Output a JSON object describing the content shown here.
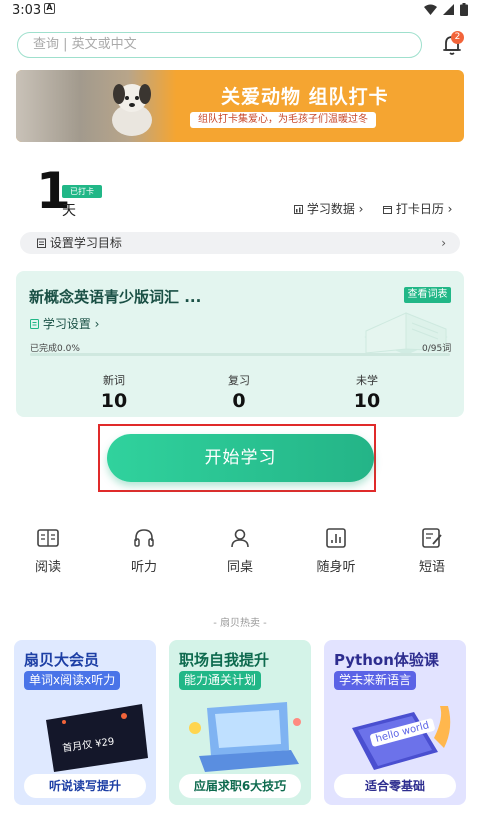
{
  "status_bar": {
    "time": "3:03",
    "notification_icon": "A"
  },
  "search": {
    "placeholder": "查询 | 英文或中文"
  },
  "notifications": {
    "count": "2"
  },
  "banner": {
    "title": "关爱动物  组队打卡",
    "subtitle": "组队打卡集爱心，为毛孩子们温暖过冬"
  },
  "checkin": {
    "days": "1",
    "tag": "已打卡",
    "unit": "天",
    "stats_link": "学习数据 ›",
    "calendar_link": "打卡日历 ›"
  },
  "goal": {
    "label": "设置学习目标",
    "arrow": "›"
  },
  "study_card": {
    "book_name": "新概念英语青少版词汇 ...",
    "vocab_button": "查看词表",
    "settings_link": "学习设置 ›",
    "progress_text": "已完成0.0%",
    "progress_fraction": 0.0,
    "progress_count": "0/95词",
    "stats": [
      {
        "label": "新词",
        "value": "10"
      },
      {
        "label": "复习",
        "value": "0"
      },
      {
        "label": "未学",
        "value": "10"
      }
    ]
  },
  "start_button": "开始学习",
  "tools": [
    {
      "label": "阅读",
      "icon": "book-icon"
    },
    {
      "label": "听力",
      "icon": "headphones-icon"
    },
    {
      "label": "同桌",
      "icon": "user-icon"
    },
    {
      "label": "随身听",
      "icon": "audio-chart-icon"
    },
    {
      "label": "短语",
      "icon": "note-pencil-icon"
    }
  ],
  "hot_section": {
    "title": "- 扇贝热卖 -"
  },
  "promos": [
    {
      "title": "扇贝大会员",
      "subtitle": "单词x阅读x听力",
      "button": "听说读写提升",
      "card_text": "首月仅 ¥29",
      "accent": "#4a74e8",
      "bg": "#dfe9ff"
    },
    {
      "title": "职场自我提升",
      "subtitle": "能力通关计划",
      "button": "应届求职6大技巧",
      "accent": "#21b787",
      "bg": "#d4f3e8"
    },
    {
      "title": "Python体验课",
      "subtitle": "学未来新语言",
      "button": "适合零基础",
      "card_text": "hello world",
      "accent": "#5b63e6",
      "bg": "#e2e3ff"
    }
  ],
  "colors": {
    "brand": "#21b787",
    "highlight_outline": "#e02a2a",
    "badge": "#f2643a"
  }
}
